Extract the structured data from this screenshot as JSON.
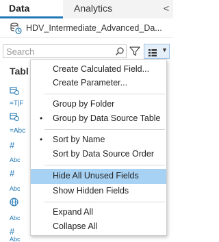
{
  "tabs": {
    "data": "Data",
    "analytics": "Analytics",
    "collapse": "<"
  },
  "datasource": {
    "name": "HDV_Intermediate_Advanced_Da..."
  },
  "search": {
    "placeholder": "Search"
  },
  "tables": {
    "label": "Tabl"
  },
  "field_icons": [
    "=T|F",
    "=Abc",
    "Abc",
    "Abc",
    "Abc",
    "Abc"
  ],
  "menu": {
    "items": [
      {
        "label": "Create Calculated Field...",
        "checked": false
      },
      {
        "label": "Create Parameter...",
        "checked": false
      },
      {
        "label": "Group by Folder",
        "checked": false
      },
      {
        "label": "Group by Data Source Table",
        "checked": true
      },
      {
        "label": "Sort by Name",
        "checked": true
      },
      {
        "label": "Sort by Data Source Order",
        "checked": false
      },
      {
        "label": "Hide All Unused Fields",
        "checked": false,
        "highlighted": true
      },
      {
        "label": "Show Hidden Fields",
        "checked": false
      },
      {
        "label": "Expand All",
        "checked": false
      },
      {
        "label": "Collapse All",
        "checked": false
      }
    ],
    "bullet": "•"
  },
  "colors": {
    "accent": "#1f77b4",
    "highlight": "#a7d2f4"
  }
}
